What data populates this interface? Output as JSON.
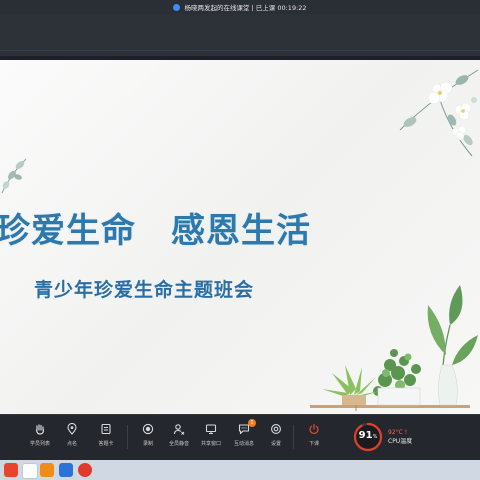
{
  "window": {
    "title": "杨晓两发起的在线课堂 | 已上课 00:19:22"
  },
  "slide": {
    "title": "珍爱生命　感恩生活",
    "subtitle": "青少年珍爱生命主题班会"
  },
  "toolbar": {
    "items": [
      {
        "label": "学员列表",
        "icon": "hand-icon"
      },
      {
        "label": "点名",
        "icon": "location-icon"
      },
      {
        "label": "答题卡",
        "icon": "card-icon"
      },
      {
        "label": "录制",
        "icon": "record-icon"
      },
      {
        "label": "全员静音",
        "icon": "mute-icon"
      },
      {
        "label": "共享窗口",
        "icon": "screen-icon"
      },
      {
        "label": "互动消息",
        "icon": "chat-icon",
        "badge": "1"
      },
      {
        "label": "设置",
        "icon": "settings-icon"
      },
      {
        "label": "下课",
        "icon": "power-icon"
      }
    ]
  },
  "cpu": {
    "percent": "91",
    "percent_unit": "%",
    "temperature": "92°C",
    "label": "CPU温度",
    "ring_fraction": 0.91,
    "alert_color": "#e0402a"
  },
  "colors": {
    "title_blue": "#2d78ad",
    "accent_blue": "#3a8ef6"
  }
}
